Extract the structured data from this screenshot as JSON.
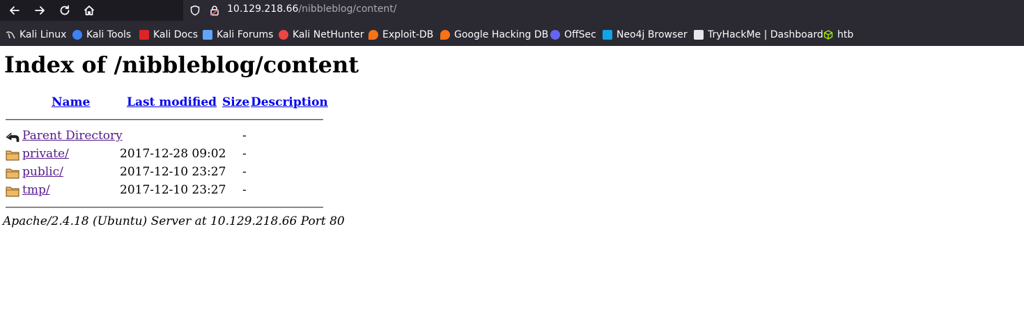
{
  "browser": {
    "url_host": "10.129.218.66",
    "url_path": "/nibbleblog/content/"
  },
  "bookmarks": [
    {
      "label": "Kali Linux",
      "icon": "kali-dragon-icon",
      "color": "#cfcfcf"
    },
    {
      "label": "Kali Tools",
      "icon": "kali-tools-icon",
      "color": "#3b82f6"
    },
    {
      "label": "Kali Docs",
      "icon": "kali-docs-icon",
      "color": "#dc2626"
    },
    {
      "label": "Kali Forums",
      "icon": "kali-forums-icon",
      "color": "#60a5fa"
    },
    {
      "label": "Kali NetHunter",
      "icon": "nethunter-icon",
      "color": "#ef4444"
    },
    {
      "label": "Exploit-DB",
      "icon": "exploit-db-icon",
      "color": "#f97316"
    },
    {
      "label": "Google Hacking DB",
      "icon": "ghdb-icon",
      "color": "#f97316"
    },
    {
      "label": "OffSec",
      "icon": "offsec-icon",
      "color": "#6366f1"
    },
    {
      "label": "Neo4j Browser",
      "icon": "neo4j-icon",
      "color": "#0ea5e9"
    },
    {
      "label": "TryHackMe | Dashboard",
      "icon": "tryhackme-icon",
      "color": "#e5e7eb"
    },
    {
      "label": "htb",
      "icon": "htb-icon",
      "color": "#9fef00"
    }
  ],
  "page": {
    "title": "Index of /nibbleblog/content",
    "columns": {
      "name": "Name",
      "last_modified": "Last modified",
      "size": "Size",
      "description": "Description"
    },
    "rows": [
      {
        "name": "Parent Directory",
        "modified": "",
        "size": "-",
        "icon": "back-arrow-icon"
      },
      {
        "name": "private/",
        "modified": "2017-12-28 09:02",
        "size": "-",
        "icon": "folder-icon"
      },
      {
        "name": "public/",
        "modified": "2017-12-10 23:27",
        "size": "-",
        "icon": "folder-icon"
      },
      {
        "name": "tmp/",
        "modified": "2017-12-10 23:27",
        "size": "-",
        "icon": "folder-icon"
      }
    ],
    "footer": "Apache/2.4.18 (Ubuntu) Server at 10.129.218.66 Port 80"
  }
}
